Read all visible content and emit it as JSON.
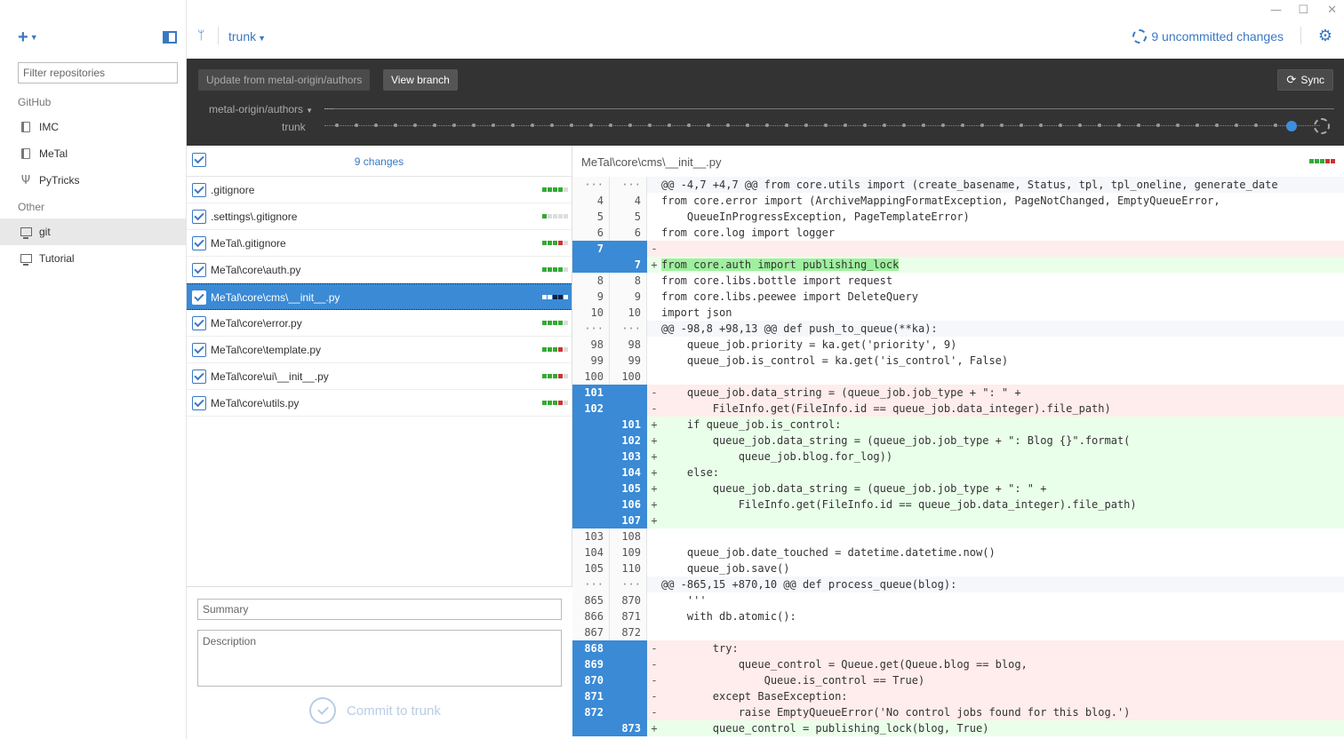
{
  "sidebar": {
    "filter_placeholder": "Filter repositories",
    "section_github": "GitHub",
    "section_other": "Other",
    "repos_github": [
      {
        "name": "IMC",
        "icon": "book-icon"
      },
      {
        "name": "MeTal",
        "icon": "book-icon"
      },
      {
        "name": "PyTricks",
        "icon": "fork-icon"
      }
    ],
    "repos_other": [
      {
        "name": "git",
        "icon": "monitor-icon",
        "active": true
      },
      {
        "name": "Tutorial",
        "icon": "monitor-icon"
      }
    ]
  },
  "header": {
    "branch": "trunk",
    "uncommitted": "9 uncommitted changes"
  },
  "syncbar": {
    "update_label": "Update from metal-origin/authors",
    "view_branch_label": "View branch",
    "sync_label": "Sync",
    "remote_branch": "metal-origin/authors",
    "local_branch": "trunk"
  },
  "changes": {
    "count_label": "9 changes",
    "files": [
      {
        "name": ".gitignore",
        "stat": [
          "#3a3",
          "#3a3",
          "#3a3",
          "#3a3",
          "#ddd"
        ]
      },
      {
        "name": ".settings\\.gitignore",
        "stat": [
          "#3a3",
          "#ddd",
          "#ddd",
          "#ddd",
          "#ddd"
        ]
      },
      {
        "name": "MeTal\\.gitignore",
        "stat": [
          "#3a3",
          "#3a3",
          "#3a3",
          "#c33",
          "#ddd"
        ]
      },
      {
        "name": "MeTal\\core\\auth.py",
        "stat": [
          "#3a3",
          "#3a3",
          "#3a3",
          "#3a3",
          "#ddd"
        ]
      },
      {
        "name": "MeTal\\core\\cms\\__init__.py",
        "stat": [
          "#fff",
          "#fff",
          "#124",
          "#124",
          "#fff"
        ],
        "selected": true
      },
      {
        "name": "MeTal\\core\\error.py",
        "stat": [
          "#3a3",
          "#3a3",
          "#3a3",
          "#3a3",
          "#ddd"
        ]
      },
      {
        "name": "MeTal\\core\\template.py",
        "stat": [
          "#3a3",
          "#3a3",
          "#3a3",
          "#c33",
          "#ddd"
        ]
      },
      {
        "name": "MeTal\\core\\ui\\__init__.py",
        "stat": [
          "#3a3",
          "#3a3",
          "#3a3",
          "#c33",
          "#ddd"
        ]
      },
      {
        "name": "MeTal\\core\\utils.py",
        "stat": [
          "#3a3",
          "#3a3",
          "#3a3",
          "#c33",
          "#ddd"
        ]
      }
    ],
    "summary_placeholder": "Summary",
    "description_placeholder": "Description",
    "commit_label": "Commit to trunk"
  },
  "diff": {
    "path": "MeTal\\core\\cms\\__init__.py",
    "stat": [
      "#3a3",
      "#3a3",
      "#3a3",
      "#c33",
      "#c33"
    ],
    "lines": [
      {
        "t": "hunk",
        "a": "···",
        "b": "···",
        "m": "",
        "c": "@@ -4,7 +4,7 @@ from core.utils import (create_basename, Status, tpl, tpl_oneline, generate_date"
      },
      {
        "t": "ctx",
        "a": "4",
        "b": "4",
        "m": "",
        "c": "from core.error import (ArchiveMappingFormatException, PageNotChanged, EmptyQueueError,"
      },
      {
        "t": "ctx",
        "a": "5",
        "b": "5",
        "m": "",
        "c": "    QueueInProgressException, PageTemplateError)"
      },
      {
        "t": "ctx",
        "a": "6",
        "b": "6",
        "m": "",
        "c": "from core.log import logger"
      },
      {
        "t": "del",
        "a": "7",
        "b": "",
        "m": "-",
        "c": ""
      },
      {
        "t": "add",
        "a": "",
        "b": "7",
        "m": "+",
        "c": "from core.auth import publishing_lock",
        "hl": true
      },
      {
        "t": "ctx",
        "a": "8",
        "b": "8",
        "m": "",
        "c": "from core.libs.bottle import request"
      },
      {
        "t": "ctx",
        "a": "9",
        "b": "9",
        "m": "",
        "c": "from core.libs.peewee import DeleteQuery"
      },
      {
        "t": "ctx",
        "a": "10",
        "b": "10",
        "m": "",
        "c": "import json"
      },
      {
        "t": "hunk",
        "a": "···",
        "b": "···",
        "m": "",
        "c": "@@ -98,8 +98,13 @@ def push_to_queue(**ka):"
      },
      {
        "t": "ctx",
        "a": "98",
        "b": "98",
        "m": "",
        "c": "    queue_job.priority = ka.get('priority', 9)"
      },
      {
        "t": "ctx",
        "a": "99",
        "b": "99",
        "m": "",
        "c": "    queue_job.is_control = ka.get('is_control', False)"
      },
      {
        "t": "ctx",
        "a": "100",
        "b": "100",
        "m": "",
        "c": ""
      },
      {
        "t": "del",
        "a": "101",
        "b": "",
        "m": "-",
        "c": "    queue_job.data_string = (queue_job.job_type + \": \" +"
      },
      {
        "t": "del",
        "a": "102",
        "b": "",
        "m": "-",
        "c": "        FileInfo.get(FileInfo.id == queue_job.data_integer).file_path)"
      },
      {
        "t": "add",
        "a": "",
        "b": "101",
        "m": "+",
        "c": "    if queue_job.is_control:"
      },
      {
        "t": "add",
        "a": "",
        "b": "102",
        "m": "+",
        "c": "        queue_job.data_string = (queue_job.job_type + \": Blog {}\".format("
      },
      {
        "t": "add",
        "a": "",
        "b": "103",
        "m": "+",
        "c": "            queue_job.blog.for_log))"
      },
      {
        "t": "add",
        "a": "",
        "b": "104",
        "m": "+",
        "c": "    else:"
      },
      {
        "t": "add",
        "a": "",
        "b": "105",
        "m": "+",
        "c": "        queue_job.data_string = (queue_job.job_type + \": \" +"
      },
      {
        "t": "add",
        "a": "",
        "b": "106",
        "m": "+",
        "c": "            FileInfo.get(FileInfo.id == queue_job.data_integer).file_path)"
      },
      {
        "t": "add",
        "a": "",
        "b": "107",
        "m": "+",
        "c": ""
      },
      {
        "t": "ctx",
        "a": "103",
        "b": "108",
        "m": "",
        "c": ""
      },
      {
        "t": "ctx",
        "a": "104",
        "b": "109",
        "m": "",
        "c": "    queue_job.date_touched = datetime.datetime.now()"
      },
      {
        "t": "ctx",
        "a": "105",
        "b": "110",
        "m": "",
        "c": "    queue_job.save()"
      },
      {
        "t": "hunk",
        "a": "···",
        "b": "···",
        "m": "",
        "c": "@@ -865,15 +870,10 @@ def process_queue(blog):"
      },
      {
        "t": "ctx",
        "a": "865",
        "b": "870",
        "m": "",
        "c": "    '''"
      },
      {
        "t": "ctx",
        "a": "866",
        "b": "871",
        "m": "",
        "c": "    with db.atomic():"
      },
      {
        "t": "ctx",
        "a": "867",
        "b": "872",
        "m": "",
        "c": ""
      },
      {
        "t": "del",
        "a": "868",
        "b": "",
        "m": "-",
        "c": "        try:"
      },
      {
        "t": "del",
        "a": "869",
        "b": "",
        "m": "-",
        "c": "            queue_control = Queue.get(Queue.blog == blog,"
      },
      {
        "t": "del",
        "a": "870",
        "b": "",
        "m": "-",
        "c": "                Queue.is_control == True)"
      },
      {
        "t": "del",
        "a": "871",
        "b": "",
        "m": "-",
        "c": "        except BaseException:"
      },
      {
        "t": "del",
        "a": "872",
        "b": "",
        "m": "-",
        "c": "            raise EmptyQueueError('No control jobs found for this blog.')"
      },
      {
        "t": "add",
        "a": "",
        "b": "873",
        "m": "+",
        "c": "        queue_control = publishing_lock(blog, True)"
      }
    ]
  }
}
